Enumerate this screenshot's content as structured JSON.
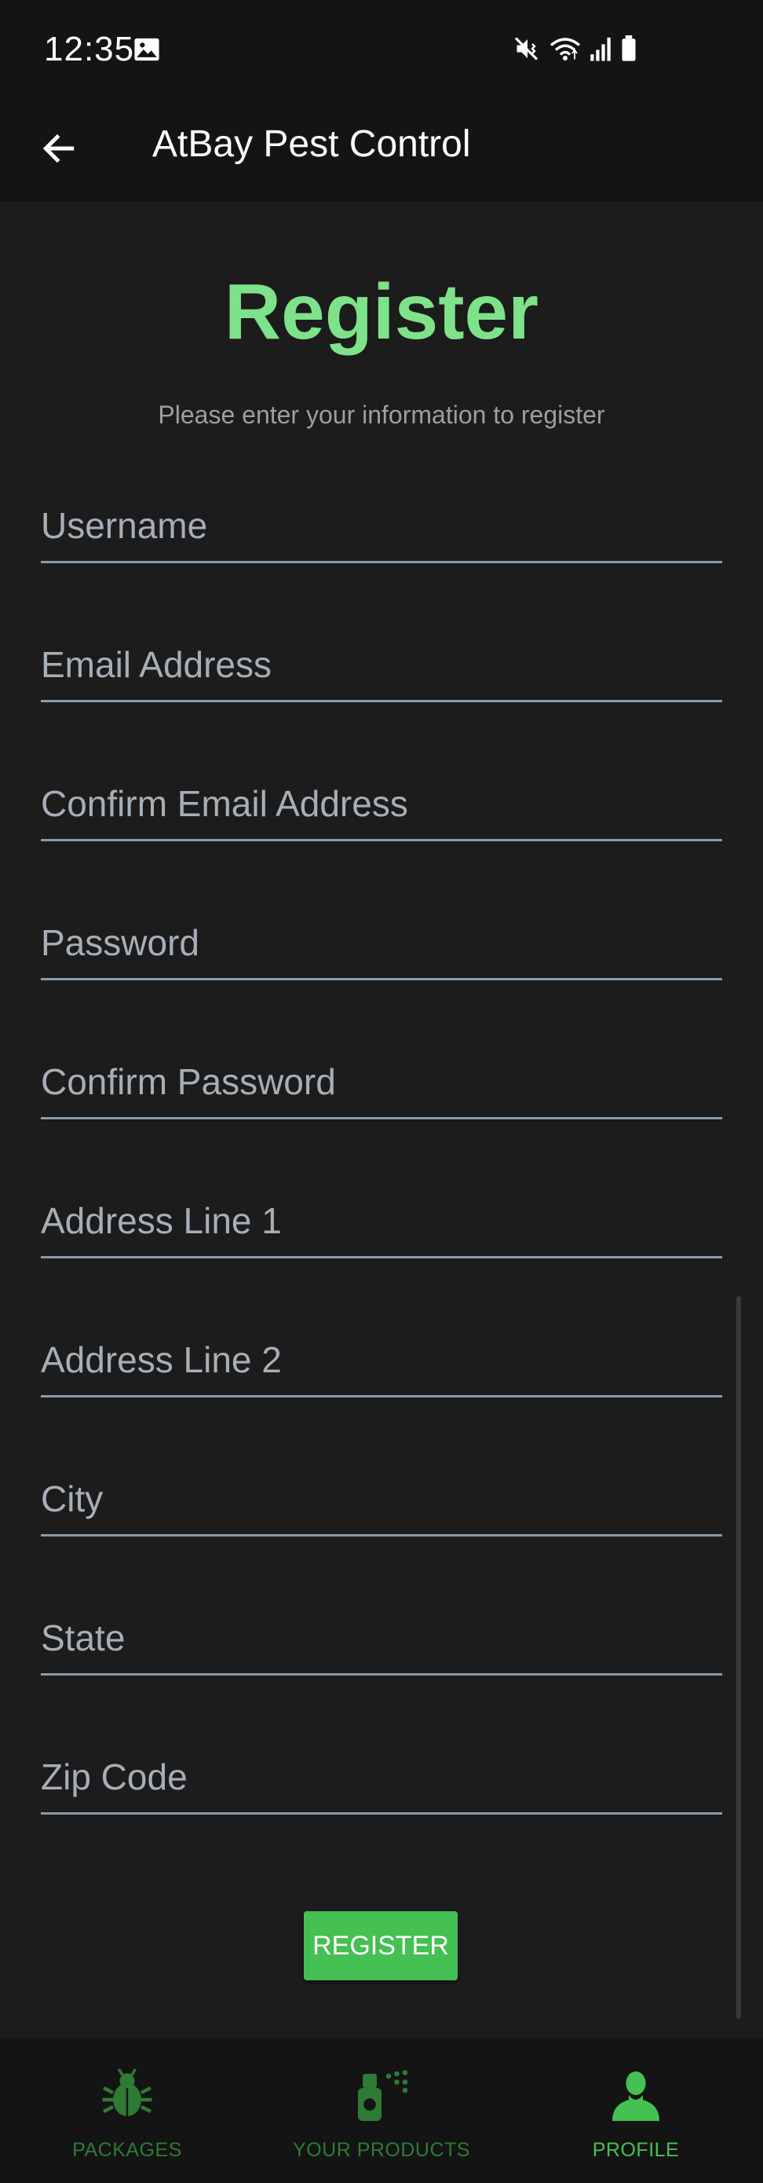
{
  "status_bar": {
    "time": "12:35"
  },
  "app_bar": {
    "title": "AtBay Pest Control"
  },
  "form": {
    "title": "Register",
    "subtitle": "Please enter your information to register",
    "fields": [
      {
        "placeholder": "Username",
        "value": ""
      },
      {
        "placeholder": "Email Address",
        "value": ""
      },
      {
        "placeholder": "Confirm Email Address",
        "value": ""
      },
      {
        "placeholder": "Password",
        "value": ""
      },
      {
        "placeholder": "Confirm Password",
        "value": ""
      },
      {
        "placeholder": "Address Line 1",
        "value": ""
      },
      {
        "placeholder": "Address Line 2",
        "value": ""
      },
      {
        "placeholder": "City",
        "value": ""
      },
      {
        "placeholder": "State",
        "value": ""
      },
      {
        "placeholder": "Zip Code",
        "value": ""
      }
    ],
    "submit_label": "REGISTER"
  },
  "bottom_nav": {
    "items": [
      {
        "label": "PACKAGES",
        "icon": "bug-icon",
        "active": false
      },
      {
        "label": "YOUR PRODUCTS",
        "icon": "spray-bottle-icon",
        "active": false
      },
      {
        "label": "PROFILE",
        "icon": "person-icon",
        "active": true
      }
    ]
  },
  "colors": {
    "accent": "#7ee28a",
    "button": "#45c052",
    "nav_inactive": "#2f7a35",
    "background": "#1c1c1c",
    "bar_background": "#141414"
  }
}
